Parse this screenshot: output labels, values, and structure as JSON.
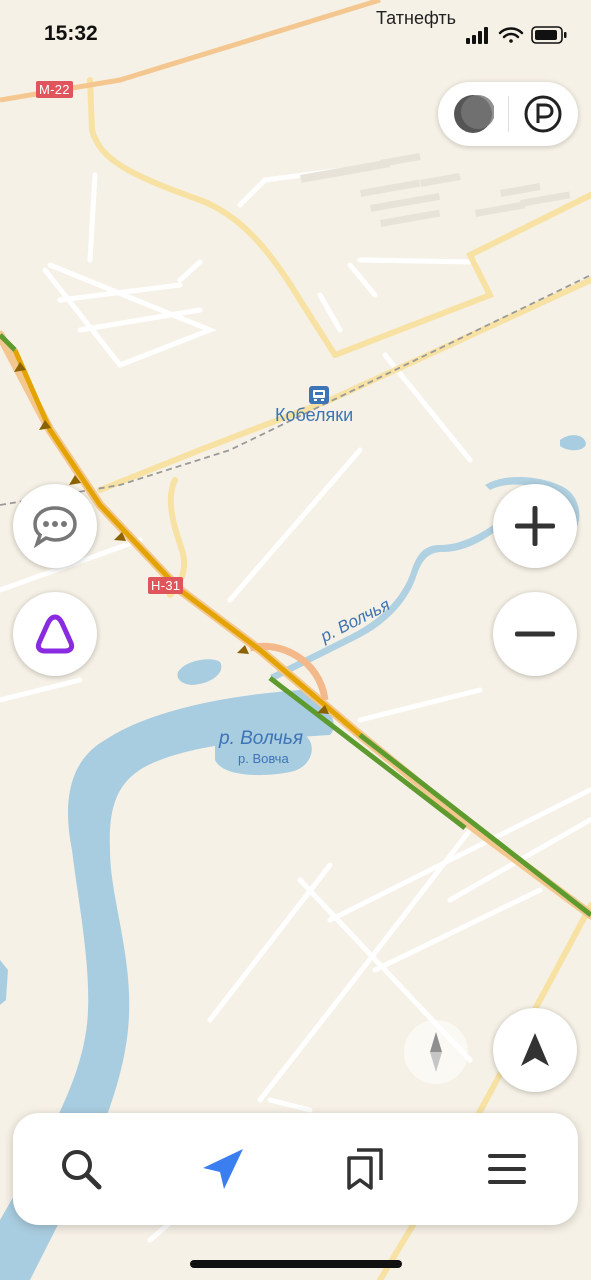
{
  "status_bar": {
    "time": "15:32",
    "carrier": "Татнефть"
  },
  "map": {
    "road_shields": [
      "M-22",
      "H-31"
    ],
    "town_label": "Кобеляки",
    "river_label_small": "р. Волчья",
    "river_label_large": "р. Волчья",
    "river_label_alt": "р. Вовча",
    "colors": {
      "land": "#f6f1e6",
      "water": "#a9cde0",
      "major_road": "#f3c78f",
      "traffic_slow": "#e3a300",
      "traffic_free": "#5e9b2f",
      "minor_road": "#ffffff",
      "label": "#3d74b5"
    }
  },
  "controls": {
    "layers_icon": "layers-icon",
    "parking_icon": "parking-icon",
    "chat_icon": "chat-bubble-icon",
    "assistant_icon": "alice-assistant-icon",
    "zoom_in_icon": "plus-icon",
    "zoom_out_icon": "minus-icon",
    "compass_icon": "compass-icon",
    "locate_icon": "navigation-arrow-icon"
  },
  "bottom_nav": {
    "items": [
      {
        "icon": "search-icon"
      },
      {
        "icon": "route-arrow-icon",
        "color": "#3a7ef0"
      },
      {
        "icon": "bookmarks-icon"
      },
      {
        "icon": "menu-icon"
      }
    ]
  }
}
